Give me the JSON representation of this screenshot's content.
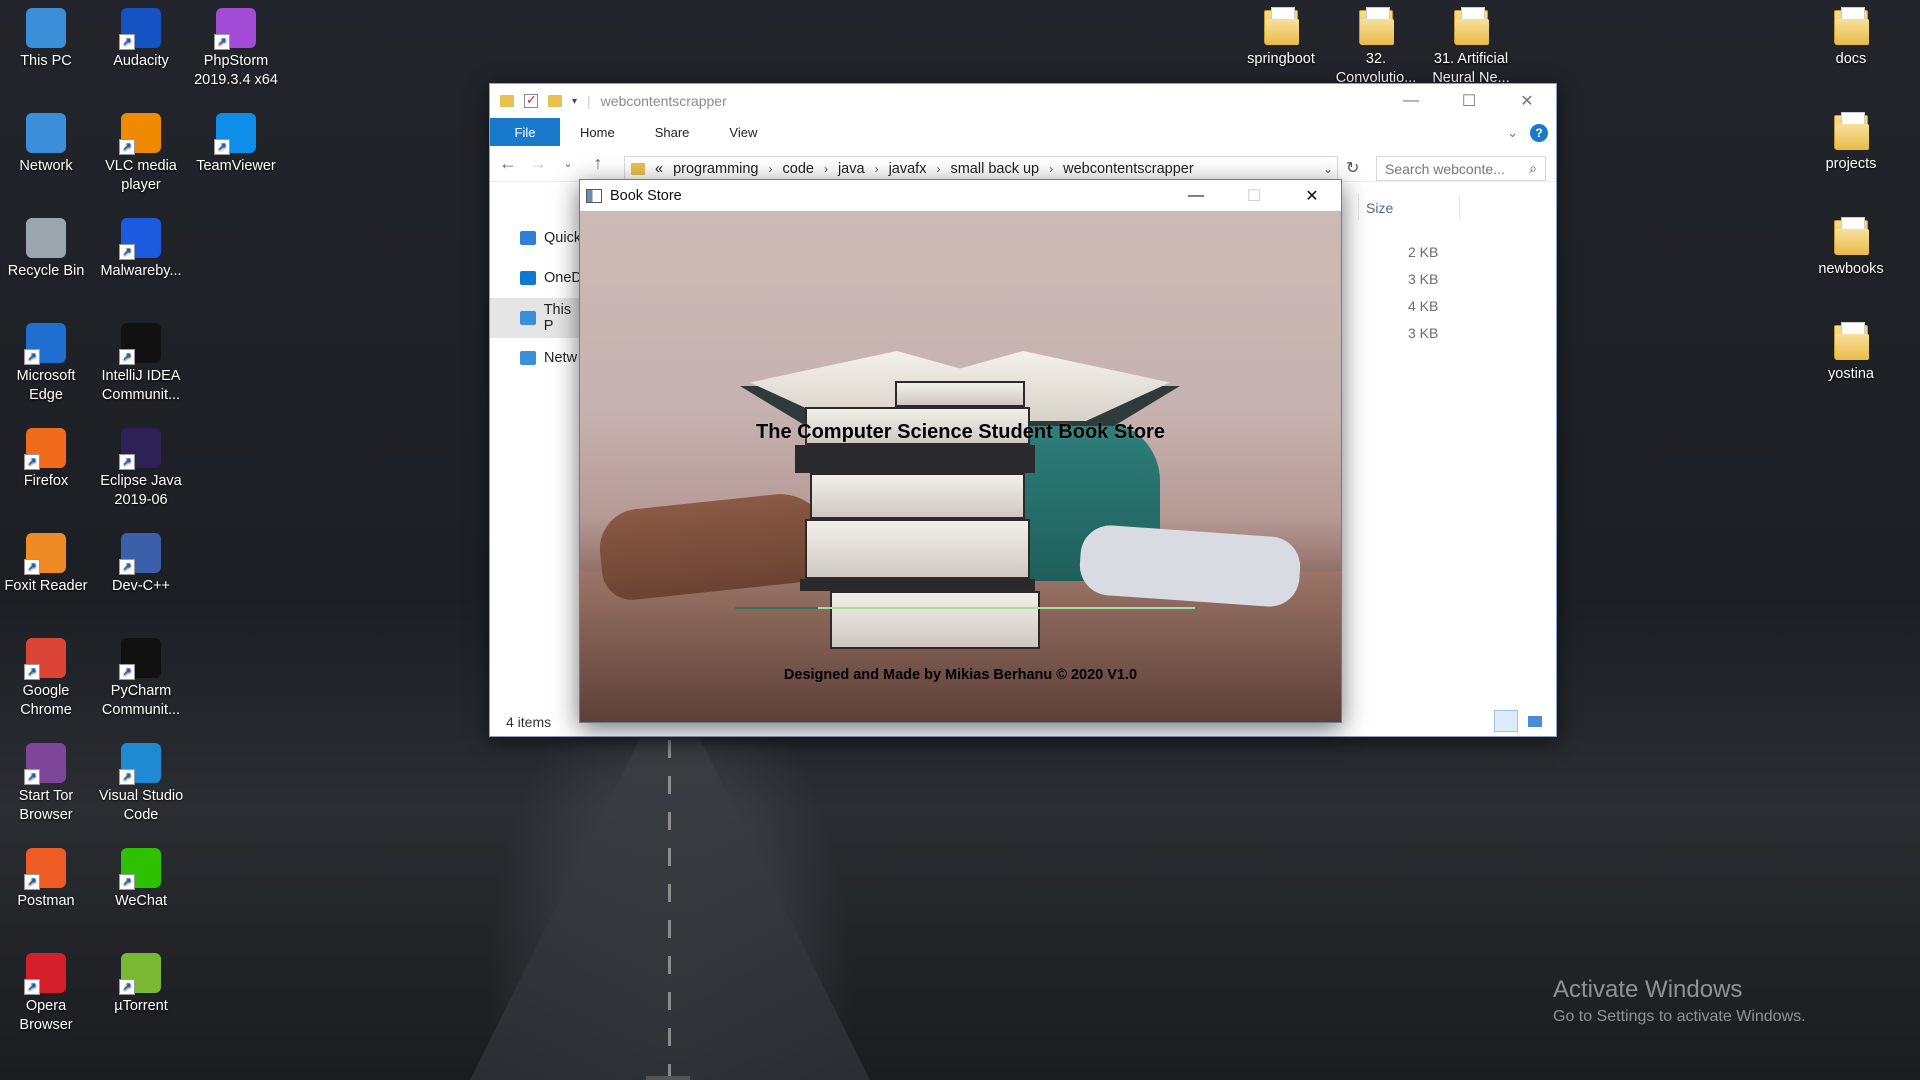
{
  "desktop": {
    "left_col1": [
      {
        "label": "This PC",
        "icon": "this-pc-icon",
        "color": "#3b8fd9"
      },
      {
        "label": "Network",
        "icon": "network-icon",
        "color": "#3b8fd9"
      },
      {
        "label": "Recycle Bin",
        "icon": "recycle-bin-icon",
        "color": "#9aa5ad"
      },
      {
        "label": "Microsoft Edge",
        "icon": "edge-icon",
        "color": "#1f6fd1"
      },
      {
        "label": "Firefox",
        "icon": "firefox-icon",
        "color": "#f06b1c"
      },
      {
        "label": "Foxit Reader",
        "icon": "foxit-reader-icon",
        "color": "#f08a24"
      },
      {
        "label": "Google Chrome",
        "icon": "chrome-icon",
        "color": "#db4437"
      },
      {
        "label": "Start Tor Browser",
        "icon": "tor-browser-icon",
        "color": "#7d4698"
      },
      {
        "label": "Postman",
        "icon": "postman-icon",
        "color": "#ef5b25"
      },
      {
        "label": "Opera Browser",
        "icon": "opera-icon",
        "color": "#d51f2b"
      }
    ],
    "left_col2": [
      {
        "label": "Audacity",
        "icon": "audacity-icon",
        "color": "#1553c4"
      },
      {
        "label": "VLC media player",
        "icon": "vlc-icon",
        "color": "#f08a00"
      },
      {
        "label": "Malwareby...",
        "icon": "malwarebytes-icon",
        "color": "#1c5ae0"
      },
      {
        "label": "IntelliJ IDEA Communit...",
        "icon": "intellij-icon",
        "color": "#111111"
      },
      {
        "label": "Eclipse Java 2019-06",
        "icon": "eclipse-icon",
        "color": "#2c2255"
      },
      {
        "label": "Dev-C++",
        "icon": "dev-cpp-icon",
        "color": "#3b5fa8"
      },
      {
        "label": "PyCharm Communit...",
        "icon": "pycharm-icon",
        "color": "#111111"
      },
      {
        "label": "Visual Studio Code",
        "icon": "vscode-icon",
        "color": "#1f8ad2"
      },
      {
        "label": "WeChat",
        "icon": "wechat-icon",
        "color": "#2dc100"
      },
      {
        "label": "µTorrent",
        "icon": "utorrent-icon",
        "color": "#78b833"
      }
    ],
    "left_col3": [
      {
        "label": "PhpStorm 2019.3.4 x64",
        "icon": "phpstorm-icon",
        "color": "#a24bd6"
      },
      {
        "label": "TeamViewer",
        "icon": "teamviewer-icon",
        "color": "#0e8ee9"
      }
    ],
    "top_folders": [
      {
        "label": "springboot",
        "icon": "folder-icon"
      },
      {
        "label": "32. Convolutio...",
        "icon": "folder-icon"
      },
      {
        "label": "31. Artificial Neural Ne...",
        "icon": "folder-icon"
      }
    ],
    "right_folders": [
      {
        "label": "docs",
        "icon": "folder-icon"
      },
      {
        "label": "projects",
        "icon": "folder-icon"
      },
      {
        "label": "newbooks",
        "icon": "folder-icon"
      },
      {
        "label": "yostina",
        "icon": "folder-icon"
      }
    ],
    "watermark": {
      "line1": "Activate Windows",
      "line2": "Go to Settings to activate Windows."
    }
  },
  "explorer": {
    "title": "webcontentscrapper",
    "ribbon_tabs": [
      "File",
      "Home",
      "Share",
      "View"
    ],
    "breadcrumb_lead": "«",
    "breadcrumb": [
      "programming",
      "code",
      "java",
      "javafx",
      "small back up",
      "webcontentscrapper"
    ],
    "search_placeholder": "Search webconte...",
    "sidebar": [
      {
        "label": "Quick",
        "icon": "star-icon",
        "color": "#2f7fd6"
      },
      {
        "label": "OneD",
        "icon": "onedrive-icon",
        "color": "#0f78d4"
      },
      {
        "label": "This P",
        "icon": "this-pc-icon",
        "color": "#3b8fd9"
      },
      {
        "label": "Netw",
        "icon": "network-icon",
        "color": "#3b8fd9"
      }
    ],
    "column_size": "Size",
    "sizes": [
      "2 KB",
      "3 KB",
      "4 KB",
      "3 KB"
    ],
    "status": "4 items"
  },
  "bookstore": {
    "title": "Book Store",
    "heading": "The Computer Science Student Book Store",
    "credit": "Designed and Made by Mikias Berhanu © 2020 V1.0",
    "progress": 0.18,
    "colors": {
      "progress_track": "#9fe39f",
      "progress_fill": "#2f7a55"
    }
  }
}
